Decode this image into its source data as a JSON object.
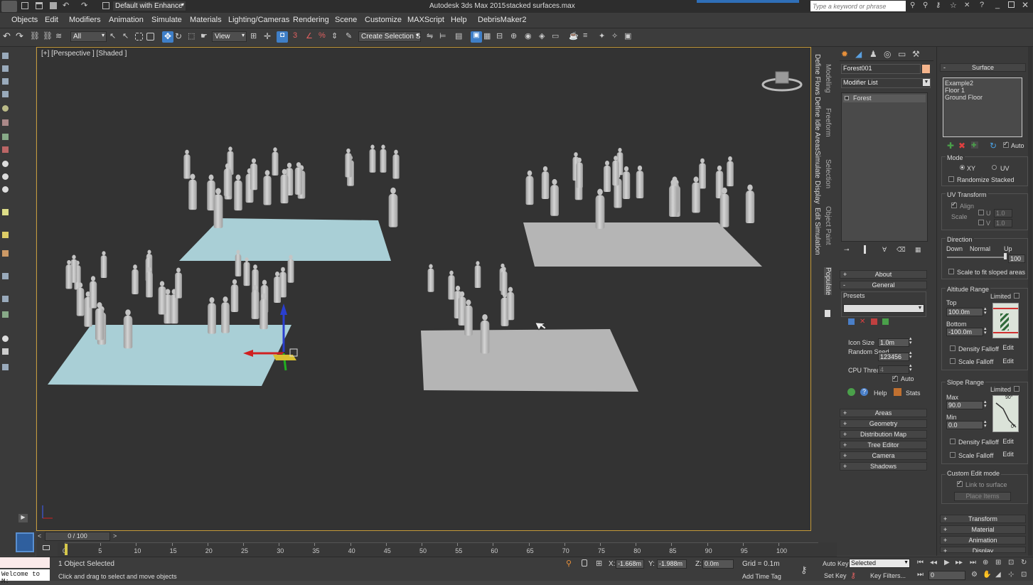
{
  "titlebar": {
    "app_title": "Autodesk 3ds Max 2015",
    "file_name": "stacked surfaces.max",
    "workspace": "Default with Enhance",
    "search_placeholder": "Type a keyword or phrase"
  },
  "menu": [
    "Objects",
    "Edit",
    "Modifiers",
    "Animation",
    "Simulate",
    "Materials",
    "Lighting/Cameras",
    "Rendering",
    "Scene",
    "Customize",
    "MAXScript",
    "Help",
    "DebrisMaker2"
  ],
  "toolbar": {
    "filter": "All",
    "ref_coord": "View",
    "selection_set": "Create Selection Se"
  },
  "viewport": {
    "label": "[+] [Perspective ] [Shaded ]"
  },
  "side_tabs_left": [
    "Define Flows",
    "Define Idle Areas",
    "Simulate",
    "Display",
    "Edit Simulation"
  ],
  "side_tabs_right": [
    "Modeling",
    "Freeform",
    "Selection",
    "Object Paint",
    "Populate"
  ],
  "command_panel": {
    "object_name": "Forest001",
    "object_color": "#f4b48c",
    "modifier_list": "Modifier List",
    "stack_item": "Forest",
    "rollouts_top": [
      "About",
      "General"
    ],
    "presets_label": "Presets",
    "icon_size_label": "Icon Size",
    "icon_size": "1.0m",
    "seed_label": "Random Seed",
    "seed": "123456",
    "cpu_label": "CPU Threads",
    "cpu": "4",
    "auto_label": "Auto",
    "help_label": "Help",
    "stats_label": "Stats",
    "rollouts_bottom": [
      "Areas",
      "Geometry",
      "Distribution Map",
      "Tree Editor",
      "Camera",
      "Shadows"
    ]
  },
  "surface_panel": {
    "title": "Surface",
    "surfaces": [
      "Example2",
      "Floor 1",
      "Ground Floor"
    ],
    "auto_label": "Auto",
    "mode_title": "Mode",
    "mode_xy": "XY",
    "mode_uv": "UV",
    "randomize": "Randomize Stacked",
    "uv_title": "UV Transform",
    "align": "Align",
    "scale_label": "Scale",
    "u_label": "U",
    "v_label": "V",
    "u_val": "1.0",
    "v_val": "1.0",
    "direction_title": "Direction",
    "down": "Down",
    "normal": "Normal",
    "up": "Up",
    "direction_val": "100",
    "scale_fit": "Scale to fit sloped areas",
    "altitude_title": "Altitude Range",
    "limited": "Limited",
    "top_label": "Top",
    "top_val": "100.0m",
    "bottom_label": "Bottom",
    "bottom_val": "-100.0m",
    "density_falloff": "Density Falloff",
    "scale_falloff": "Scale Falloff",
    "edit": "Edit",
    "slope_title": "Slope Range",
    "max_label": "Max",
    "max_val": "90.0",
    "min_label": "Min",
    "min_val": "0.0",
    "slope_top": "90°",
    "slope_bottom": "0°",
    "custom_title": "Custom Edit mode",
    "link_surface": "Link to surface",
    "place_items": "Place Items",
    "rollouts_bottom": [
      "Transform",
      "Material",
      "Animation",
      "Display"
    ]
  },
  "timeline": {
    "frame": "0 / 100",
    "ticks": [
      "0",
      "5",
      "10",
      "15",
      "20",
      "25",
      "30",
      "35",
      "40",
      "45",
      "50",
      "55",
      "60",
      "65",
      "70",
      "75",
      "80",
      "85",
      "90",
      "95",
      "100"
    ]
  },
  "status": {
    "script_listener": "Welcome to M:",
    "selection": "1 Object Selected",
    "prompt": "Click and drag to select and move objects",
    "x_label": "X:",
    "x_val": "-1.668m",
    "y_label": "Y:",
    "y_val": "-1.988m",
    "z_label": "Z:",
    "z_val": "0.0m",
    "grid": "Grid = 0.1m",
    "add_time_tag": "Add Time Tag",
    "auto_key": "Auto Key",
    "key_mode": "Selected",
    "set_key": "Set Key",
    "key_filters": "Key Filters...",
    "frame_field": "0"
  }
}
